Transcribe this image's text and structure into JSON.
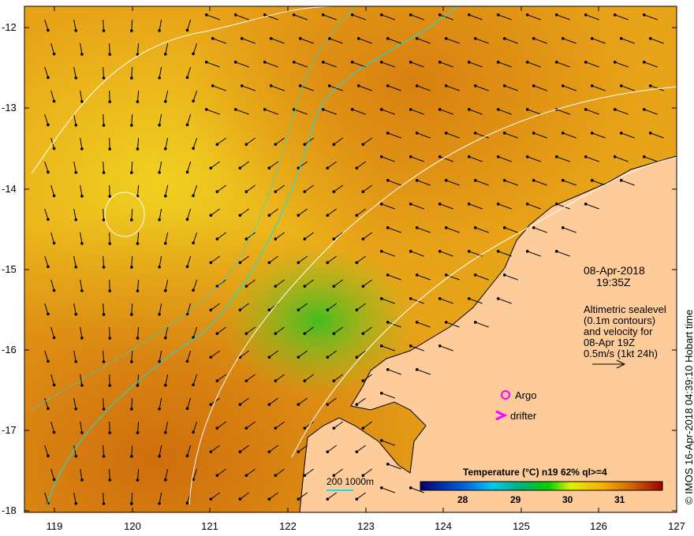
{
  "map": {
    "lon_ticks": [
      "119",
      "120",
      "121",
      "122",
      "123",
      "124",
      "125",
      "126",
      "127"
    ],
    "lat_ticks": [
      "-12",
      "-13",
      "-14",
      "-15",
      "-16",
      "-17",
      "-18"
    ],
    "lon_range": [
      118.62,
      127
    ],
    "lat_range": [
      -11.73,
      -18.02
    ]
  },
  "info": {
    "date": "08-Apr-2018",
    "time": "19:35Z",
    "altimetry_lines": [
      "Altimetric sealevel",
      "(0.1m contours)",
      "and velocity for",
      "08-Apr 19Z",
      "0.5m/s (1kt 24h)"
    ]
  },
  "legend": {
    "argo": "Argo",
    "drifter": "drifter",
    "bathy_label": "200  1000m",
    "colorbar_title": "Temperature (°C) n19 62% ql>=4",
    "colorbar_ticks": [
      "28",
      "29",
      "30",
      "31"
    ],
    "colorbar_range": [
      27.2,
      31.85
    ]
  },
  "credit": "© IMOS 16-Apr-2018 04:39:10 Hobart time",
  "colors": {
    "land": "#fecb9a",
    "sst_warm": "#e8a010",
    "sst_mid": "#f2c21a",
    "argo": "#ff00ff",
    "bathy": "#00e5ee"
  }
}
